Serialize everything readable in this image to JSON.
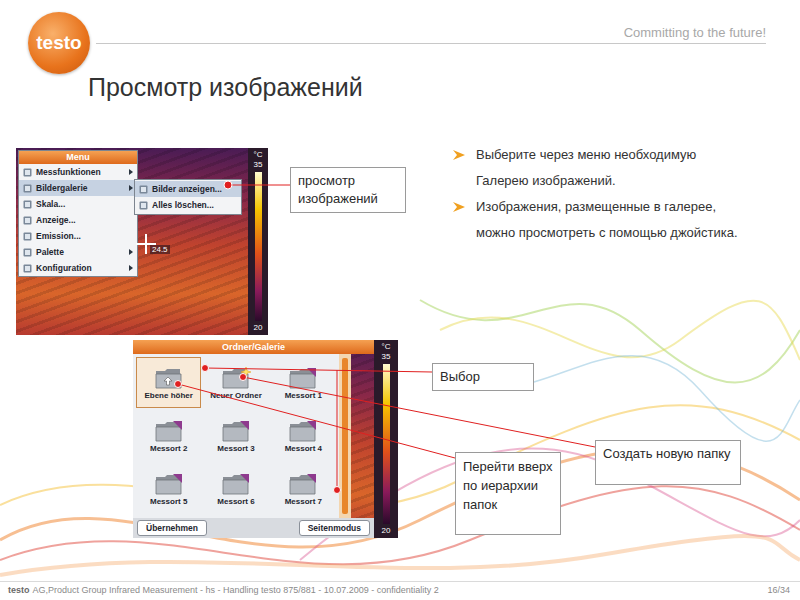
{
  "header": {
    "logo": "testo",
    "tagline": "Committing to the future!"
  },
  "title": "Просмотр изображений",
  "bullets": [
    "Выберите через меню необходимую Галерею изображений.",
    "Изображения, размещенные в галерее, можно просмотреть с помощью джойстика."
  ],
  "menu_screen": {
    "menu_title": "Menu",
    "items": [
      {
        "label": "Messfunktionen",
        "has_submenu": true,
        "selected": false
      },
      {
        "label": "Bildergalerie",
        "has_submenu": true,
        "selected": true
      },
      {
        "label": "Skala...",
        "has_submenu": false,
        "selected": false
      },
      {
        "label": "Anzeige...",
        "has_submenu": false,
        "selected": false
      },
      {
        "label": "Emission...",
        "has_submenu": false,
        "selected": false
      },
      {
        "label": "Palette",
        "has_submenu": true,
        "selected": false
      },
      {
        "label": "Konfiguration",
        "has_submenu": true,
        "selected": false
      }
    ],
    "submenu": [
      {
        "label": "Bilder anzeigen...",
        "selected": true
      },
      {
        "label": "Alles löschen...",
        "selected": false
      }
    ],
    "reading": "24.5",
    "scale": {
      "unit": "°C",
      "max": "35",
      "min": "20"
    }
  },
  "gallery_screen": {
    "title": "Ordner/Galerie",
    "folders": [
      {
        "label": "Ebene höher",
        "kind": "up",
        "selected": true
      },
      {
        "label": "Neuer Ordner",
        "kind": "new",
        "selected": false
      },
      {
        "label": "Messort 1",
        "kind": "folder",
        "selected": false
      },
      {
        "label": "Messort 2",
        "kind": "folder",
        "selected": false
      },
      {
        "label": "Messort 3",
        "kind": "folder",
        "selected": false
      },
      {
        "label": "Messort 4",
        "kind": "folder",
        "selected": false
      },
      {
        "label": "Messort 5",
        "kind": "folder",
        "selected": false
      },
      {
        "label": "Messort 6",
        "kind": "folder",
        "selected": false
      },
      {
        "label": "Messort 7",
        "kind": "folder",
        "selected": false
      }
    ],
    "buttons": [
      "Übernehmen",
      "Seitenmodus"
    ],
    "scale": {
      "unit": "°C",
      "max": "35",
      "min": "20"
    }
  },
  "callouts": {
    "view": "просмотр изображений",
    "select": "Выбор",
    "new_folder": "Создать новую папку",
    "up": "Перейти вверх по иерархии папок"
  },
  "footer": {
    "brand": "testo",
    "text": "AG,Product Group Infrared Measurement - hs - Handling testo 875/881 - 10.07.2009 - confidentiality 2",
    "page": "16/34"
  }
}
